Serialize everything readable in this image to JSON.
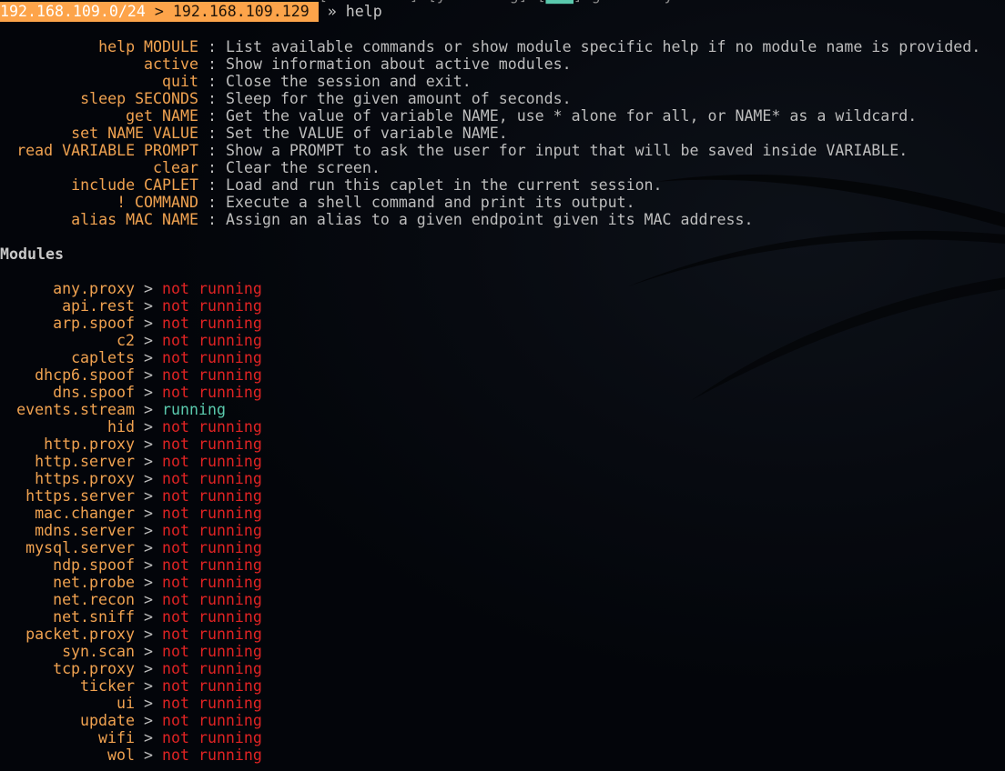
{
  "prompt": {
    "subnet": "192.168.109.0/24",
    "separator": ">",
    "host": "192.168.109.129",
    "arrow": "»",
    "command": "help"
  },
  "help": {
    "commands": [
      {
        "name": "help MODULE",
        "description": "List available commands or show module specific help if no module name is provided."
      },
      {
        "name": "active",
        "description": "Show information about active modules."
      },
      {
        "name": "quit",
        "description": "Close the session and exit."
      },
      {
        "name": "sleep SECONDS",
        "description": "Sleep for the given amount of seconds."
      },
      {
        "name": "get NAME",
        "description": "Get the value of variable NAME, use * alone for all, or NAME* as a wildcard."
      },
      {
        "name": "set NAME VALUE",
        "description": "Set the VALUE of variable NAME."
      },
      {
        "name": "read VARIABLE PROMPT",
        "description": "Show a PROMPT to ask the user for input that will be saved inside VARIABLE."
      },
      {
        "name": "clear",
        "description": "Clear the screen."
      },
      {
        "name": "include CAPLET",
        "description": "Load and run this caplet in the current session."
      },
      {
        "name": "! COMMAND",
        "description": "Execute a shell command and print its output."
      },
      {
        "name": "alias MAC NAME",
        "description": "Assign an alias to a given endpoint given its MAC address."
      }
    ],
    "separator": ":"
  },
  "modules": {
    "heading": "Modules",
    "separator": ">",
    "items": [
      {
        "name": "any.proxy",
        "status": "not running",
        "running": false
      },
      {
        "name": "api.rest",
        "status": "not running",
        "running": false
      },
      {
        "name": "arp.spoof",
        "status": "not running",
        "running": false
      },
      {
        "name": "c2",
        "status": "not running",
        "running": false
      },
      {
        "name": "caplets",
        "status": "not running",
        "running": false
      },
      {
        "name": "dhcp6.spoof",
        "status": "not running",
        "running": false
      },
      {
        "name": "dns.spoof",
        "status": "not running",
        "running": false
      },
      {
        "name": "events.stream",
        "status": "running",
        "running": true
      },
      {
        "name": "hid",
        "status": "not running",
        "running": false
      },
      {
        "name": "http.proxy",
        "status": "not running",
        "running": false
      },
      {
        "name": "http.server",
        "status": "not running",
        "running": false
      },
      {
        "name": "https.proxy",
        "status": "not running",
        "running": false
      },
      {
        "name": "https.server",
        "status": "not running",
        "running": false
      },
      {
        "name": "mac.changer",
        "status": "not running",
        "running": false
      },
      {
        "name": "mdns.server",
        "status": "not running",
        "running": false
      },
      {
        "name": "mysql.server",
        "status": "not running",
        "running": false
      },
      {
        "name": "ndp.spoof",
        "status": "not running",
        "running": false
      },
      {
        "name": "net.probe",
        "status": "not running",
        "running": false
      },
      {
        "name": "net.recon",
        "status": "not running",
        "running": false
      },
      {
        "name": "net.sniff",
        "status": "not running",
        "running": false
      },
      {
        "name": "packet.proxy",
        "status": "not running",
        "running": false
      },
      {
        "name": "syn.scan",
        "status": "not running",
        "running": false
      },
      {
        "name": "tcp.proxy",
        "status": "not running",
        "running": false
      },
      {
        "name": "ticker",
        "status": "not running",
        "running": false
      },
      {
        "name": "ui",
        "status": "not running",
        "running": false
      },
      {
        "name": "update",
        "status": "not running",
        "running": false
      },
      {
        "name": "wifi",
        "status": "not running",
        "running": false
      },
      {
        "name": "wol",
        "status": "not running",
        "running": false
      }
    ]
  },
  "colors": {
    "prompt_band": "#fda44a",
    "command_name": "#f0a250",
    "description": "#c6c6c6",
    "not_running": "#e02323",
    "running": "#5ac9ad",
    "background": "#03060c"
  }
}
